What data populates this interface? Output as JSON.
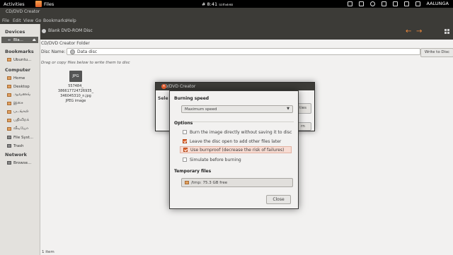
{
  "topbar": {
    "activities": "Activities",
    "app_name": "Files",
    "clock_prefix": "#",
    "clock": "8:41 மாலை",
    "user": "AALUNGA"
  },
  "window": {
    "title": "CD/DVD Creator"
  },
  "menu": [
    "File",
    "Edit",
    "View",
    "Go",
    "Bookmarks",
    "Help"
  ],
  "sidebar": {
    "devices_heading": "Devices",
    "devices": [
      "Bla..."
    ],
    "bookmarks_heading": "Bookmarks",
    "bookmarks": [
      "Ubuntu..."
    ],
    "computer_heading": "Computer",
    "computer": [
      "Home",
      "Desktop",
      "ஆவணங்",
      "இசை",
      "படங்கள்",
      "பதிவிறக்",
      "வீடியோ",
      "File Syst...",
      "Trash"
    ],
    "network_heading": "Network",
    "network": [
      "Browse..."
    ]
  },
  "toolbar": {
    "tab_label": "Blank DVD-ROM Disc"
  },
  "content": {
    "folder_strip": "CD/DVD Creator Folder",
    "disc_name_label": "Disc Name:",
    "disc_name_value": "Data disc",
    "write_button": "Write to Disc",
    "hint": "Drag or copy files below to write them to disc",
    "file": {
      "icon_label": "JPG",
      "name_line1": "557484_",
      "name_line2": "386617724726935_",
      "name_line3": "346045310_n.jpg",
      "type": "JPEG image"
    },
    "status": "1 item"
  },
  "dialog_back": {
    "title": "CD/DVD Creator",
    "select_label": "Sele",
    "properties_fragment": "ties",
    "burn_fragment": "rn"
  },
  "dialog": {
    "burning_speed_heading": "Burning speed",
    "speed_value": "Maximum speed",
    "options_heading": "Options",
    "options": [
      {
        "label": "Burn the image directly without saving it to disc",
        "checked": false
      },
      {
        "label": "Leave the disc open to add other files later",
        "checked": true
      },
      {
        "label": "Use burnproof (decrease the risk of failures)",
        "checked": true
      },
      {
        "label": "Simulate before burning",
        "checked": false
      }
    ],
    "temp_heading": "Temporary files",
    "temp_value": "/tmp: 75.3 GB free",
    "close_button": "Close"
  },
  "colors": {
    "accent": "#e0632b",
    "panel": "#3c3b37",
    "background": "#f2f1f0"
  }
}
